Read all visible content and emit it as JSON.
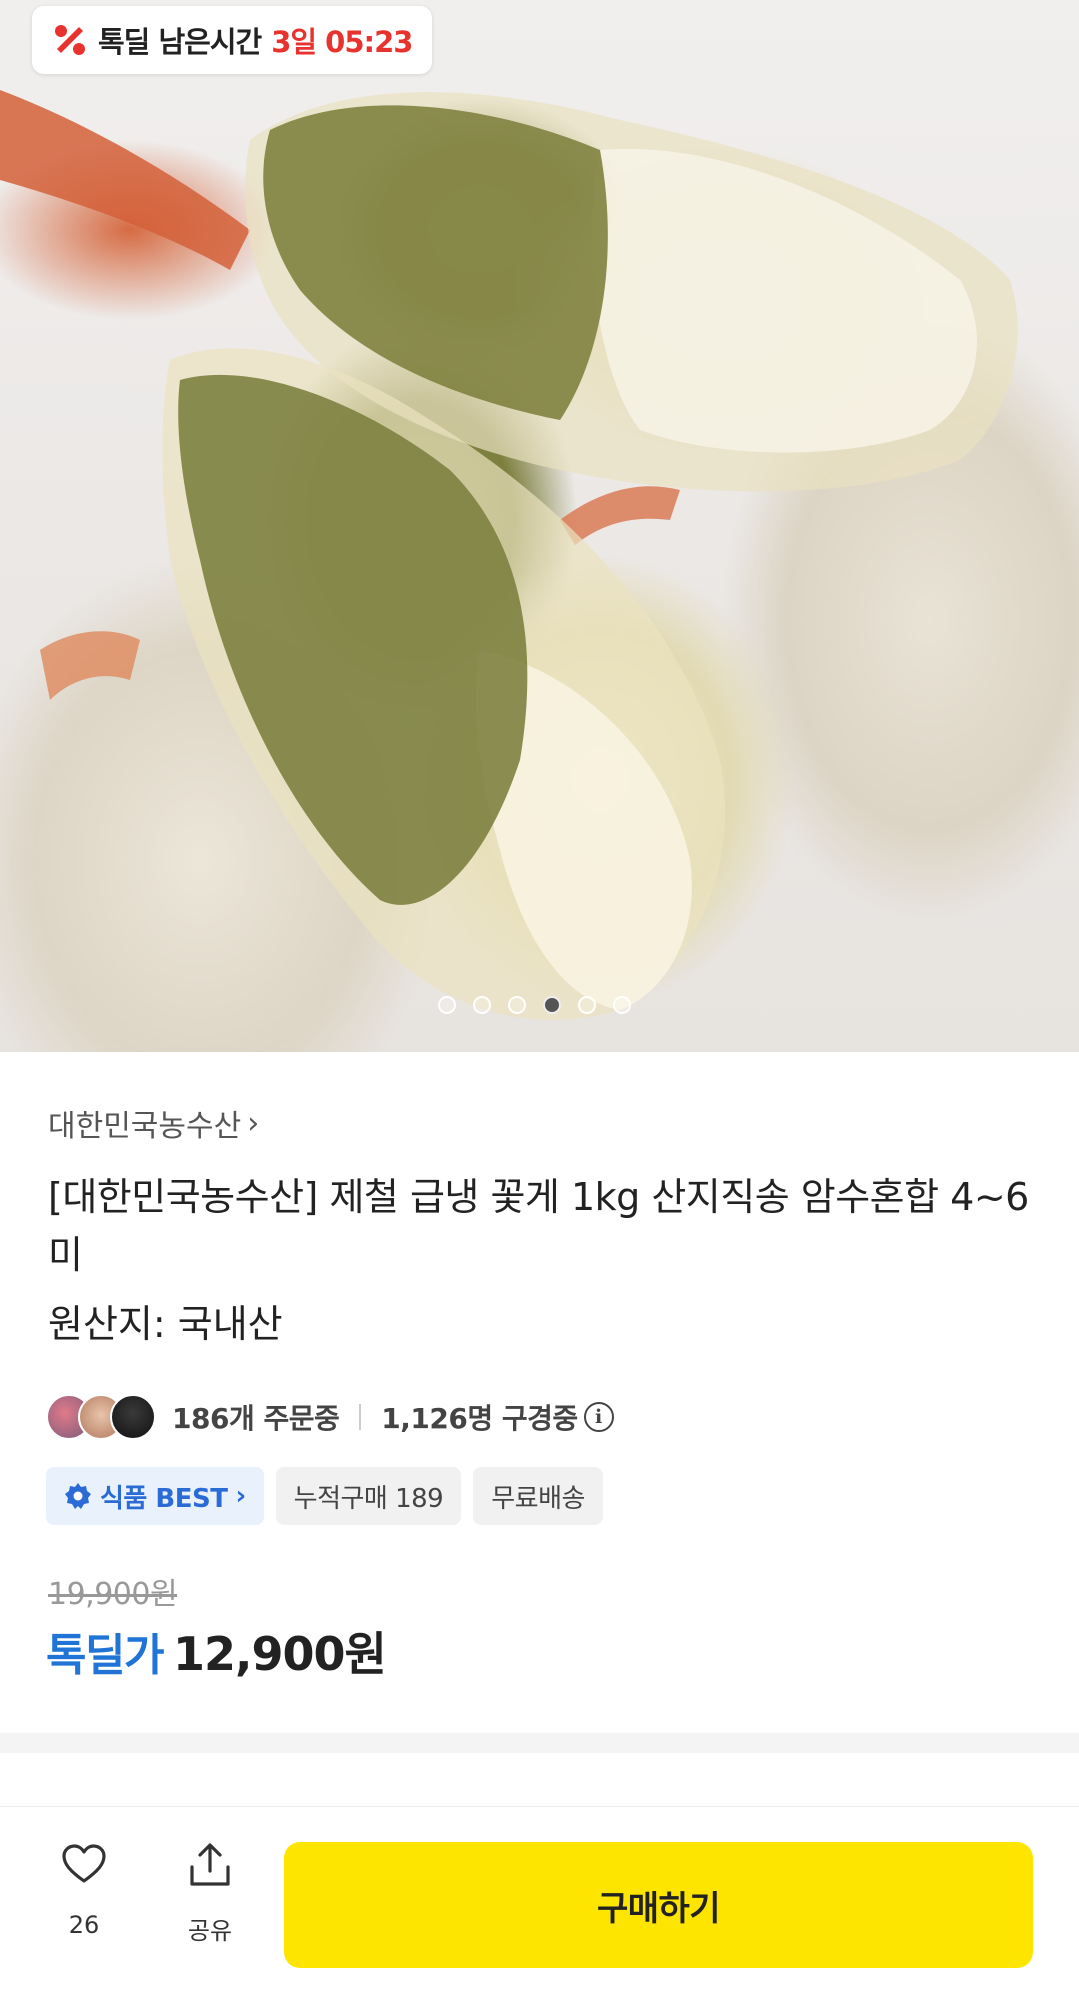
{
  "timer": {
    "label": "톡딜 남은시간",
    "time": "3일 05:23"
  },
  "gallery": {
    "dot_count": 6,
    "active_index": 3
  },
  "product": {
    "seller": "대한민국농수산",
    "title": "[대한민국농수산] 제철 급냉 꽃게 1kg 산지직송 암수혼합 4~6미",
    "origin": "원산지: 국내산"
  },
  "stats": {
    "orders": "186개 주문중",
    "viewers": "1,126명 구경중"
  },
  "chips": {
    "best": "식품 BEST",
    "cumulative": "누적구매 189",
    "shipping": "무료배송"
  },
  "price": {
    "original": "19,900원",
    "deal_label": "톡딜가",
    "deal_price": "12,900원"
  },
  "bottom_bar": {
    "like_count": "26",
    "share_label": "공유",
    "buy_label": "구매하기"
  },
  "colors": {
    "accent_red": "#e8322e",
    "deal_blue": "#1f74d6",
    "buy_yellow": "#fee500"
  }
}
